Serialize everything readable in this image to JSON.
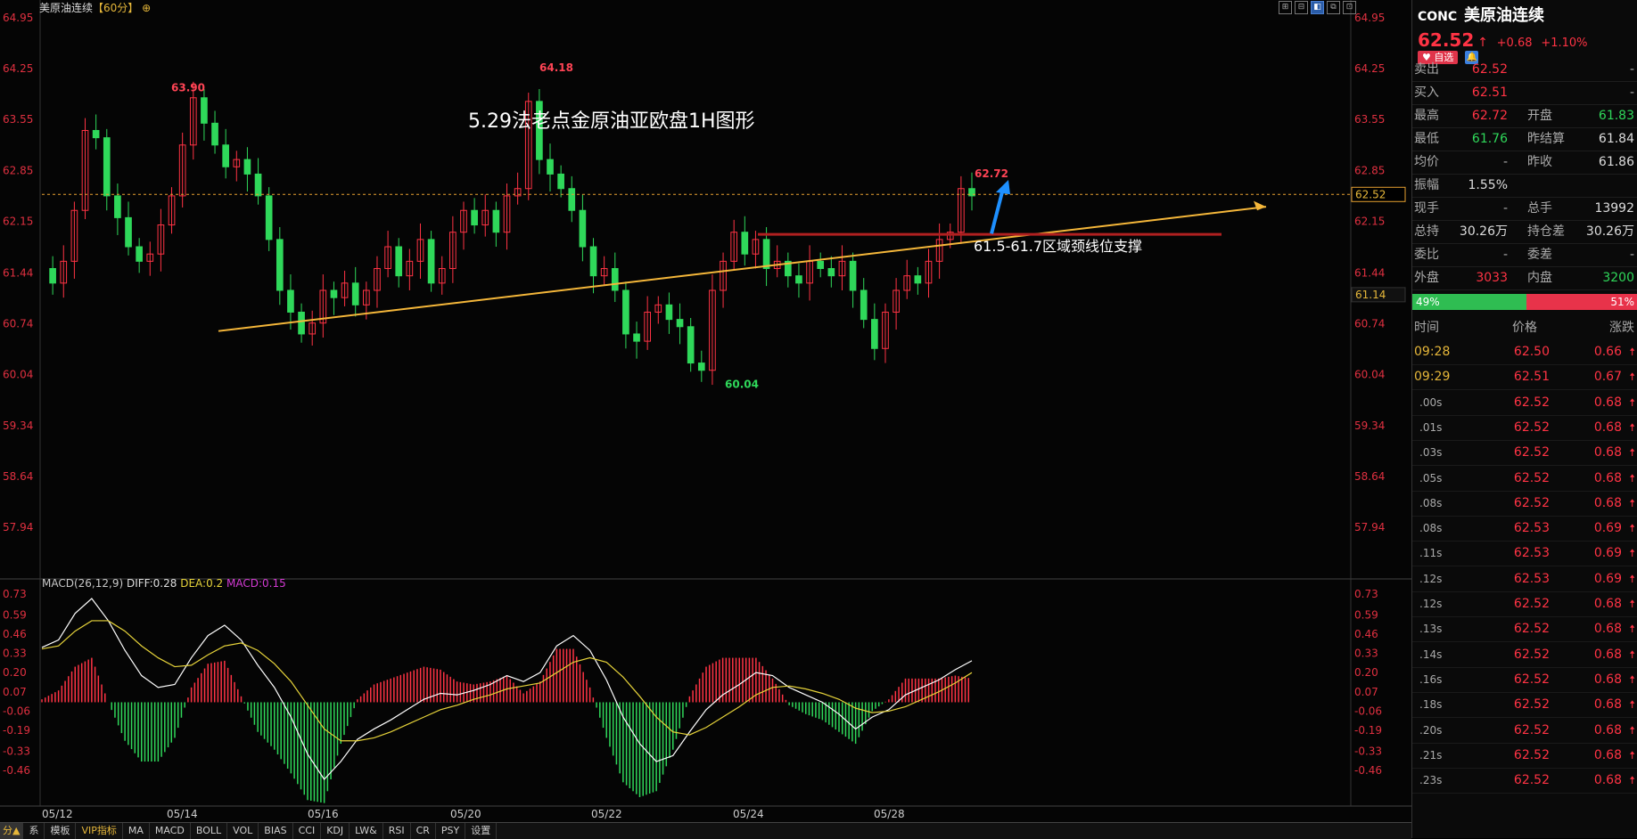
{
  "header": {
    "title": "美原油连续",
    "period": "【60分】",
    "settings_icon": "gear-icon"
  },
  "annotation_title": "5.29法老点金原油亚欧盘1H图形",
  "annotation_support": "61.5-61.7区域颈线位支撑",
  "colors": {
    "up": "#ff3344",
    "down": "#2fd85a",
    "dea": "#e6d33a",
    "macd_label": "#d33ad3",
    "trend": "#f5b73a",
    "support": "#b02020",
    "arrow": "#1e90ff"
  },
  "price_labels": {
    "high1": "63.90",
    "high2": "64.18",
    "low": "60.04",
    "last_high": "62.72",
    "current_tag": "62.52",
    "cursor_tag": "61.14"
  },
  "chart_data": [
    {
      "type": "candlestick",
      "title": "美原油连续【60分】",
      "y_ticks": [
        "64.95",
        "64.25",
        "63.55",
        "62.85",
        "62.15",
        "61.44",
        "60.74",
        "60.04",
        "59.34",
        "58.64",
        "57.94"
      ],
      "ylim": [
        57.94,
        64.95
      ],
      "x_ticks": [
        "05/12",
        "05/14",
        "05/16",
        "05/20",
        "05/22",
        "05/24",
        "05/28"
      ],
      "current_price": 62.52,
      "marked": {
        "high_1": 63.9,
        "high_2": 64.18,
        "low": 60.04,
        "last_high": 62.72
      },
      "series_path": [
        61.5,
        61.3,
        61.6,
        62.3,
        63.4,
        63.3,
        62.5,
        62.2,
        61.8,
        61.6,
        61.7,
        62.1,
        62.5,
        63.2,
        63.85,
        63.5,
        63.2,
        62.9,
        63.0,
        62.8,
        62.5,
        61.9,
        61.2,
        60.9,
        60.6,
        60.75,
        61.2,
        61.1,
        61.3,
        61.0,
        61.2,
        61.5,
        61.8,
        61.4,
        61.6,
        61.9,
        61.3,
        61.5,
        62.0,
        62.3,
        62.1,
        62.3,
        62.0,
        62.5,
        62.6,
        63.8,
        63.0,
        62.8,
        62.6,
        62.3,
        61.8,
        61.4,
        61.5,
        61.2,
        60.6,
        60.5,
        60.9,
        61.0,
        60.8,
        60.7,
        60.2,
        60.1,
        61.2,
        61.6,
        62.0,
        61.7,
        61.9,
        61.5,
        61.6,
        61.4,
        61.3,
        61.6,
        61.5,
        61.4,
        61.6,
        61.2,
        60.8,
        60.4,
        60.9,
        61.2,
        61.4,
        61.3,
        61.6,
        61.9,
        62.0,
        62.6,
        62.5
      ]
    },
    {
      "type": "macd",
      "title": "MACD(26,12,9)",
      "y_ticks": [
        "0.73",
        "0.59",
        "0.46",
        "0.33",
        "0.20",
        "0.07",
        "-0.06",
        "-0.19",
        "-0.33",
        "-0.46"
      ],
      "ylim": [
        -0.55,
        0.73
      ],
      "series": [
        {
          "name": "DIFF",
          "last": 0.28
        },
        {
          "name": "DEA",
          "last": 0.2
        },
        {
          "name": "MACD",
          "last": 0.15
        }
      ],
      "diff_path": [
        0.37,
        0.42,
        0.6,
        0.7,
        0.55,
        0.35,
        0.18,
        0.1,
        0.12,
        0.3,
        0.45,
        0.52,
        0.42,
        0.25,
        0.1,
        -0.1,
        -0.35,
        -0.52,
        -0.4,
        -0.25,
        -0.18,
        -0.12,
        -0.05,
        0.02,
        0.06,
        0.05,
        0.08,
        0.12,
        0.18,
        0.14,
        0.2,
        0.38,
        0.45,
        0.35,
        0.15,
        -0.1,
        -0.28,
        -0.4,
        -0.36,
        -0.2,
        -0.05,
        0.05,
        0.12,
        0.2,
        0.18,
        0.1,
        0.05,
        0.0,
        -0.08,
        -0.18,
        -0.1,
        -0.05,
        0.05,
        0.1,
        0.15,
        0.22,
        0.28
      ],
      "dea_path": [
        0.36,
        0.38,
        0.48,
        0.55,
        0.55,
        0.48,
        0.38,
        0.3,
        0.24,
        0.25,
        0.32,
        0.38,
        0.4,
        0.35,
        0.26,
        0.14,
        -0.02,
        -0.18,
        -0.26,
        -0.26,
        -0.24,
        -0.2,
        -0.15,
        -0.1,
        -0.05,
        -0.02,
        0.02,
        0.05,
        0.09,
        0.11,
        0.13,
        0.2,
        0.27,
        0.3,
        0.27,
        0.17,
        0.04,
        -0.1,
        -0.2,
        -0.22,
        -0.17,
        -0.1,
        -0.03,
        0.05,
        0.1,
        0.11,
        0.09,
        0.06,
        0.02,
        -0.04,
        -0.07,
        -0.06,
        -0.03,
        0.02,
        0.07,
        0.13,
        0.2
      ]
    }
  ],
  "right_panel": {
    "code": "CONC",
    "name": "美原油连续",
    "price": "62.52",
    "change": "+0.68",
    "change_pct": "+1.10%",
    "fav_label": "自选",
    "bell_icon": "bell-icon",
    "quotes": [
      {
        "l1": "卖出",
        "v1": "62.52",
        "c1": "red",
        "l2": "",
        "v2": "-",
        "c2": "gray"
      },
      {
        "l1": "买入",
        "v1": "62.51",
        "c1": "red",
        "l2": "",
        "v2": "-",
        "c2": "gray"
      },
      {
        "l1": "最高",
        "v1": "62.72",
        "c1": "red",
        "l2": "开盘",
        "v2": "61.83",
        "c2": "green"
      },
      {
        "l1": "最低",
        "v1": "61.76",
        "c1": "green",
        "l2": "昨结算",
        "v2": "61.84",
        "c2": "white"
      },
      {
        "l1": "均价",
        "v1": "-",
        "c1": "gray",
        "l2": "昨收",
        "v2": "61.86",
        "c2": "white"
      },
      {
        "l1": "振幅",
        "v1": "1.55%",
        "c1": "white",
        "l2": "",
        "v2": "",
        "c2": "white"
      },
      {
        "l1": "现手",
        "v1": "-",
        "c1": "gray",
        "l2": "总手",
        "v2": "13992",
        "c2": "white"
      },
      {
        "l1": "总持",
        "v1": "30.26万",
        "c1": "white",
        "l2": "持仓差",
        "v2": "30.26万",
        "c2": "white"
      },
      {
        "l1": "委比",
        "v1": "-",
        "c1": "gray",
        "l2": "委差",
        "v2": "-",
        "c2": "gray"
      },
      {
        "l1": "外盘",
        "v1": "3033",
        "c1": "red",
        "l2": "内盘",
        "v2": "3200",
        "c2": "green"
      }
    ],
    "buy_pct": "49%",
    "sell_pct": "51%",
    "buy_fraction": 0.49,
    "tick_headers": [
      "时间",
      "价格",
      "涨跌"
    ],
    "ticks": [
      {
        "time": "09:28",
        "price": "62.50",
        "chg": "0.66",
        "hl": true
      },
      {
        "time": "09:29",
        "price": "62.51",
        "chg": "0.67",
        "hl": true
      },
      {
        "time": ".00s",
        "price": "62.52",
        "chg": "0.68",
        "hl": false
      },
      {
        "time": ".01s",
        "price": "62.52",
        "chg": "0.68",
        "hl": false
      },
      {
        "time": ".03s",
        "price": "62.52",
        "chg": "0.68",
        "hl": false
      },
      {
        "time": ".05s",
        "price": "62.52",
        "chg": "0.68",
        "hl": false
      },
      {
        "time": ".08s",
        "price": "62.52",
        "chg": "0.68",
        "hl": false
      },
      {
        "time": ".08s",
        "price": "62.53",
        "chg": "0.69",
        "hl": false
      },
      {
        "time": ".11s",
        "price": "62.53",
        "chg": "0.69",
        "hl": false
      },
      {
        "time": ".12s",
        "price": "62.53",
        "chg": "0.69",
        "hl": false
      },
      {
        "time": ".12s",
        "price": "62.52",
        "chg": "0.68",
        "hl": false
      },
      {
        "time": ".13s",
        "price": "62.52",
        "chg": "0.68",
        "hl": false
      },
      {
        "time": ".14s",
        "price": "62.52",
        "chg": "0.68",
        "hl": false
      },
      {
        "time": ".16s",
        "price": "62.52",
        "chg": "0.68",
        "hl": false
      },
      {
        "time": ".18s",
        "price": "62.52",
        "chg": "0.68",
        "hl": false
      },
      {
        "time": ".20s",
        "price": "62.52",
        "chg": "0.68",
        "hl": false
      },
      {
        "time": ".21s",
        "price": "62.52",
        "chg": "0.68",
        "hl": false
      },
      {
        "time": ".23s",
        "price": "62.52",
        "chg": "0.68",
        "hl": false
      }
    ]
  },
  "indicator_tabs": {
    "period_tab": "分▲",
    "items": [
      "系",
      "模板",
      "VIP指标",
      "MA",
      "MACD",
      "BOLL",
      "VOL",
      "BIAS",
      "CCI",
      "KDJ",
      "LW&",
      "RSI",
      "CR",
      "PSY",
      "设置"
    ]
  }
}
